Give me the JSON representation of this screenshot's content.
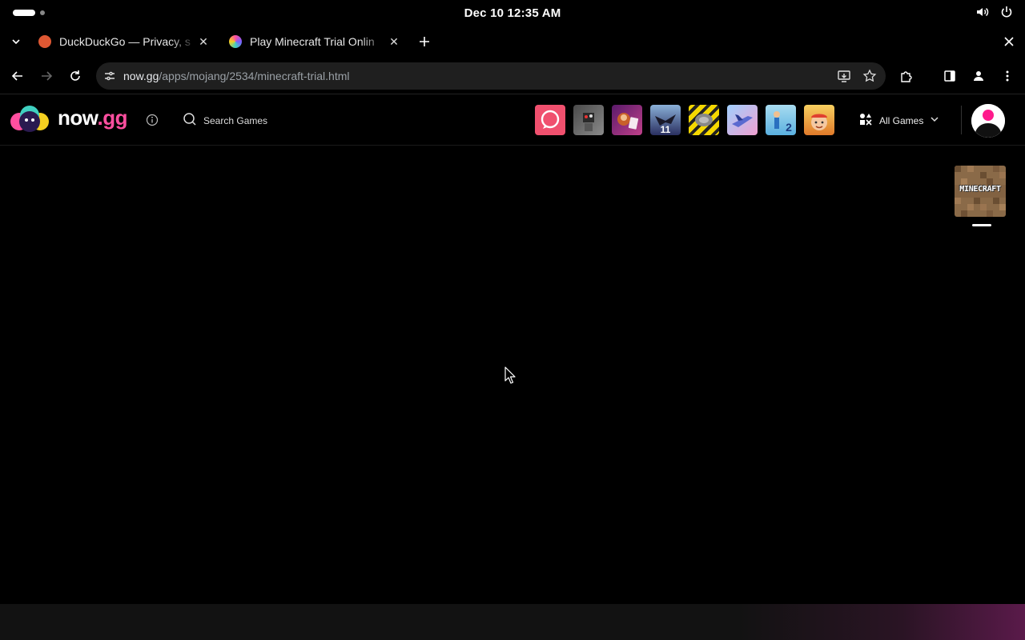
{
  "system": {
    "clock": "Dec 10  12:35 AM"
  },
  "tabs": [
    {
      "title": "DuckDuckGo — Privacy, s",
      "favicon_color": "#de5833"
    },
    {
      "title": "Play Minecraft Trial Onlin",
      "favicon_color": "#7a5cff"
    }
  ],
  "toolbar": {
    "url_host": "now.gg",
    "url_path": "/apps/mojang/2534/minecraft-trial.html"
  },
  "site": {
    "brand_main": "now",
    "brand_accent": ".gg",
    "search_label": "Search Games",
    "all_games_label": "All Games",
    "accent_color": "#ff4fa0",
    "game_icons": [
      {
        "name": "chat-app-icon",
        "color": "#f0506e"
      },
      {
        "name": "robot-game-icon",
        "color": "#6b6b6b"
      },
      {
        "name": "cards-game-icon",
        "color": "#8a2a7a"
      },
      {
        "name": "dragon-game-icon",
        "color": "#3a3f78"
      },
      {
        "name": "racing-game-icon",
        "color": "#e8c800"
      },
      {
        "name": "plane-game-icon",
        "color": "#5a8ae0"
      },
      {
        "name": "puzzle-2-game-icon",
        "color": "#7dc0e0"
      },
      {
        "name": "chef-game-icon",
        "color": "#e89a2a"
      }
    ]
  },
  "main": {
    "thumb_label": "MINECRAFT"
  }
}
